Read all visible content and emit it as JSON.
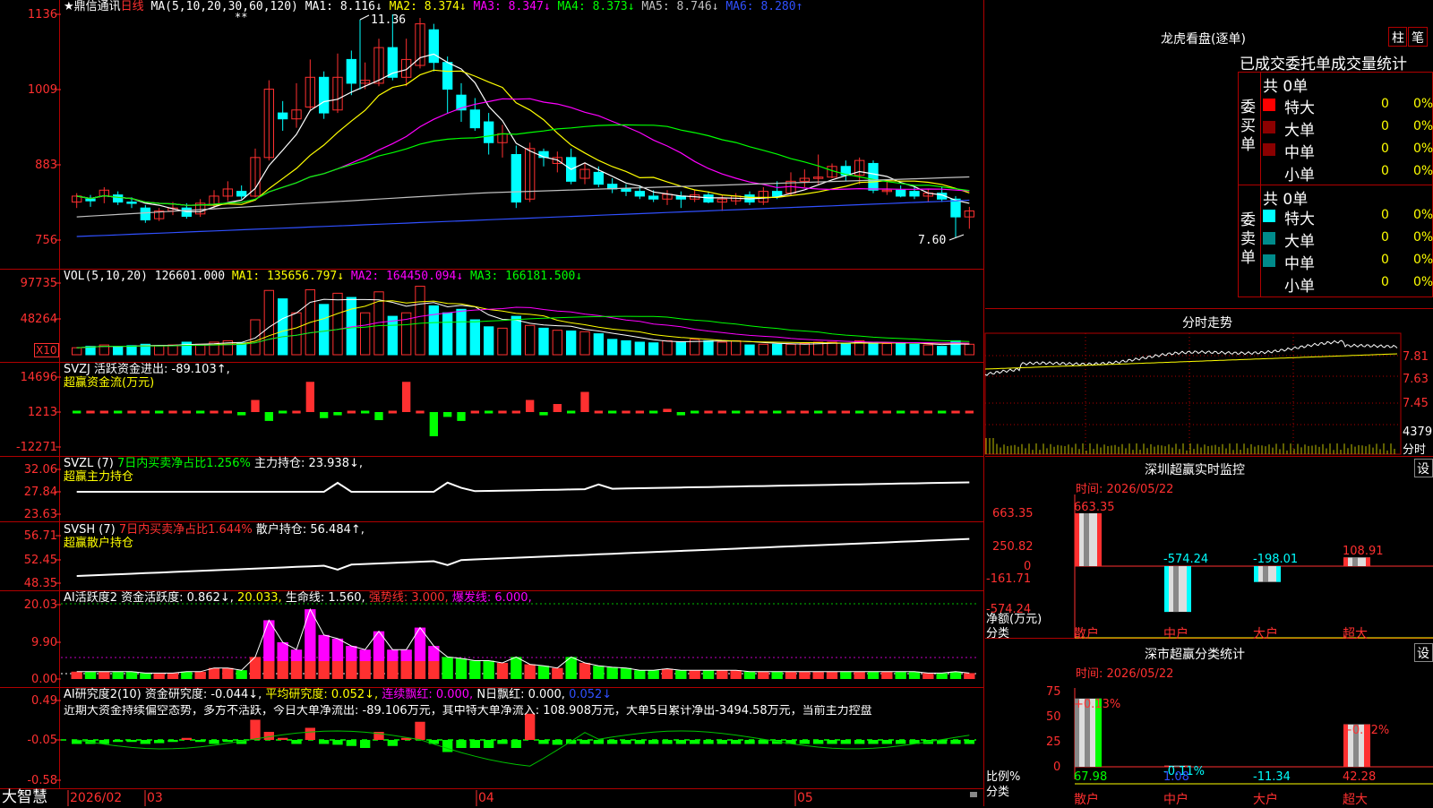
{
  "stock": {
    "name": "★鼎信通讯",
    "period": "日线",
    "ma_label": "MA(5,10,20,30,60,120)",
    "ma": [
      {
        "name": "MA1:",
        "value": "8.116",
        "dir": "↓",
        "color": "#ffffff"
      },
      {
        "name": "MA2:",
        "value": "8.374",
        "dir": "↓",
        "color": "#ffff00"
      },
      {
        "name": "MA3:",
        "value": "8.347",
        "dir": "↓",
        "color": "#ff00ff"
      },
      {
        "name": "MA4:",
        "value": "8.373",
        "dir": "↓",
        "color": "#00ff00"
      },
      {
        "name": "MA5:",
        "value": "8.746",
        "dir": "↓",
        "color": "#c0c0c0"
      },
      {
        "name": "MA6:",
        "value": "8.280",
        "dir": "↑",
        "color": "#3050ff"
      }
    ],
    "high_label": "11.36",
    "low_label": "7.60",
    "stars": "**",
    "y_ticks": [
      "1136",
      "1009",
      "883",
      "756"
    ]
  },
  "vol": {
    "label": "VOL(5,10,20)",
    "value": "126601.000",
    "ma1": "MA1: 135656.797↓",
    "ma2": "MA2: 164450.094↓",
    "ma3": "MA3: 166181.500↓",
    "y_ticks": [
      "97735",
      "48264"
    ],
    "unit": "X10"
  },
  "svzj": {
    "label": "SVZJ",
    "text": "活跃资金进出: -89.103↑,",
    "sub": "超赢资金流(万元)",
    "y_ticks": [
      "14696",
      "1213",
      "-12271"
    ]
  },
  "svzl": {
    "label": "SVZL (7)",
    "text1": "7日内买卖净占比1.256%",
    "text2": "主力持仓: 23.938↓,",
    "sub": "超赢主力持仓",
    "y_ticks": [
      "32.06",
      "27.84",
      "23.63"
    ]
  },
  "svsh": {
    "label": "SVSH (7)",
    "text1": "7日内买卖净占比1.644%",
    "text2": "散户持仓: 56.484↑,",
    "sub": "超赢散户持仓",
    "y_ticks": [
      "56.71",
      "52.45",
      "48.35"
    ]
  },
  "ai1": {
    "label": "AI活跃度2",
    "t1": "资金活跃度: 0.862↓,",
    "t2": "20.033,",
    "t3": "生命线: 1.560,",
    "t4": "强势线: 3.000,",
    "t5": "爆发线: 6.000,",
    "y_ticks": [
      "20.03",
      "9.90",
      "0.00"
    ]
  },
  "ai2": {
    "label": "AI研究度2(10)",
    "t1": "资金研究度: -0.044↓,",
    "t2": "平均研究度: 0.052↓,",
    "t3": "连续飘红: 0.000,",
    "t4": "N日飘红: 0.000,",
    "t5": "0.052↓",
    "comment": "近期大资金持续偏空态势，多方不活跃，今日大单净流出: -89.106万元，其中特大单净流入: 108.908万元，大单5日累计净出-3494.58万元，当前主力控盘",
    "y_ticks": [
      "0.49",
      "-0.05",
      "-0.58"
    ]
  },
  "bottom": {
    "brand": "大智慧",
    "dates": [
      "2026/02",
      "03",
      "04",
      "05"
    ]
  },
  "right": {
    "tabs": [
      "柱",
      "笔"
    ],
    "dragon_title": "龙虎看盘(逐单)",
    "header": "已成交委托单成交量统计",
    "buy_label": "委买单",
    "sell_label": "委卖单",
    "buy_total": "共 0单",
    "sell_total": "共 0单",
    "buy_rows": [
      {
        "name": "特大",
        "count": "0",
        "pct": "0%",
        "color": "#ff0000"
      },
      {
        "name": "大单",
        "count": "0",
        "pct": "0%",
        "color": "#8b0000"
      },
      {
        "name": "中单",
        "count": "0",
        "pct": "0%",
        "color": "#8b0000"
      },
      {
        "name": "小单",
        "count": "0",
        "pct": "0%",
        "color": ""
      }
    ],
    "sell_rows": [
      {
        "name": "特大",
        "count": "0",
        "pct": "0%",
        "color": "#00ffff"
      },
      {
        "name": "大单",
        "count": "0",
        "pct": "0%",
        "color": "#008b8b"
      },
      {
        "name": "中单",
        "count": "0",
        "pct": "0%",
        "color": "#008b8b"
      },
      {
        "name": "小单",
        "count": "0",
        "pct": "0%",
        "color": ""
      }
    ],
    "intraday_title": "分时走势",
    "intraday_ticks": [
      "7.81",
      "7.63",
      "7.45"
    ],
    "intraday_vol": "4379",
    "intraday_vol_label": "分时",
    "monitor_title": "深圳超赢实时监控",
    "monitor_time": "时间: 2026/05/22",
    "monitor_ticks": [
      "663.35",
      "250.82",
      "0",
      "-161.71",
      "-574.24"
    ],
    "monitor_ylabel": "净额(万元)",
    "monitor_xlabel": "分类",
    "monitor_bars": [
      {
        "cat": "散户",
        "value": 663.35,
        "label": "663.35"
      },
      {
        "cat": "中户",
        "value": -574.24,
        "label": "-574.24"
      },
      {
        "cat": "大户",
        "value": -198.01,
        "label": "-198.01"
      },
      {
        "cat": "超大",
        "value": 108.91,
        "label": "108.91"
      }
    ],
    "class_title": "深市超赢分类统计",
    "class_time": "时间: 2026/05/22",
    "class_ticks": [
      "75",
      "50",
      "25",
      "0"
    ],
    "class_ylabel": "比例%",
    "class_xlabel": "分类",
    "class_bars": [
      {
        "cat": "散户",
        "value": 67.98,
        "top": "+0.13%",
        "bottom": "67.98"
      },
      {
        "cat": "中户",
        "value": 1.08,
        "top": "-0.11%",
        "bottom": "1.08"
      },
      {
        "cat": "大户",
        "value": -11.34,
        "top": "",
        "bottom": "-11.34"
      },
      {
        "cat": "超大",
        "value": 42.28,
        "top": "+0.02%",
        "bottom": "42.28"
      }
    ],
    "settings": "设"
  },
  "colors": {
    "up": "#ff3030",
    "down": "#00ffff",
    "grid": "#b00000"
  }
}
